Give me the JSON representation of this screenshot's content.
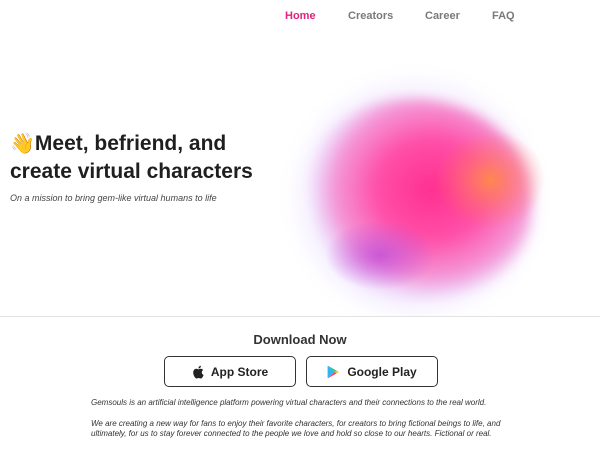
{
  "nav": {
    "items": [
      {
        "label": "Home",
        "active": true
      },
      {
        "label": "Creators",
        "active": false
      },
      {
        "label": "Career",
        "active": false
      },
      {
        "label": "FAQ",
        "active": false
      }
    ]
  },
  "hero": {
    "emoji": "👋",
    "headline_line1": "Meet, befriend, and",
    "headline_line2": "create virtual characters",
    "tagline": "On a mission to bring gem-like virtual humans to life"
  },
  "download": {
    "title": "Download Now",
    "app_store_label": "App Store",
    "google_play_label": "Google Play"
  },
  "about": {
    "paragraph1": "Gemsouls is an artificial intelligence platform powering virtual characters and their connections to the real world.",
    "paragraph2": "We are creating a new way for fans to enjoy their favorite characters, for creators to bring fictional beings to life, and ultimately, for us to stay forever connected to the people we love and hold so close to our hearts. Fictional or real."
  },
  "colors": {
    "accent": "#e0237e",
    "nav_inactive": "#7a7a7a",
    "blob_pink": "#ff2f9a",
    "blob_orange": "#ff8a4a",
    "blob_lavender": "#d7c9ff"
  }
}
